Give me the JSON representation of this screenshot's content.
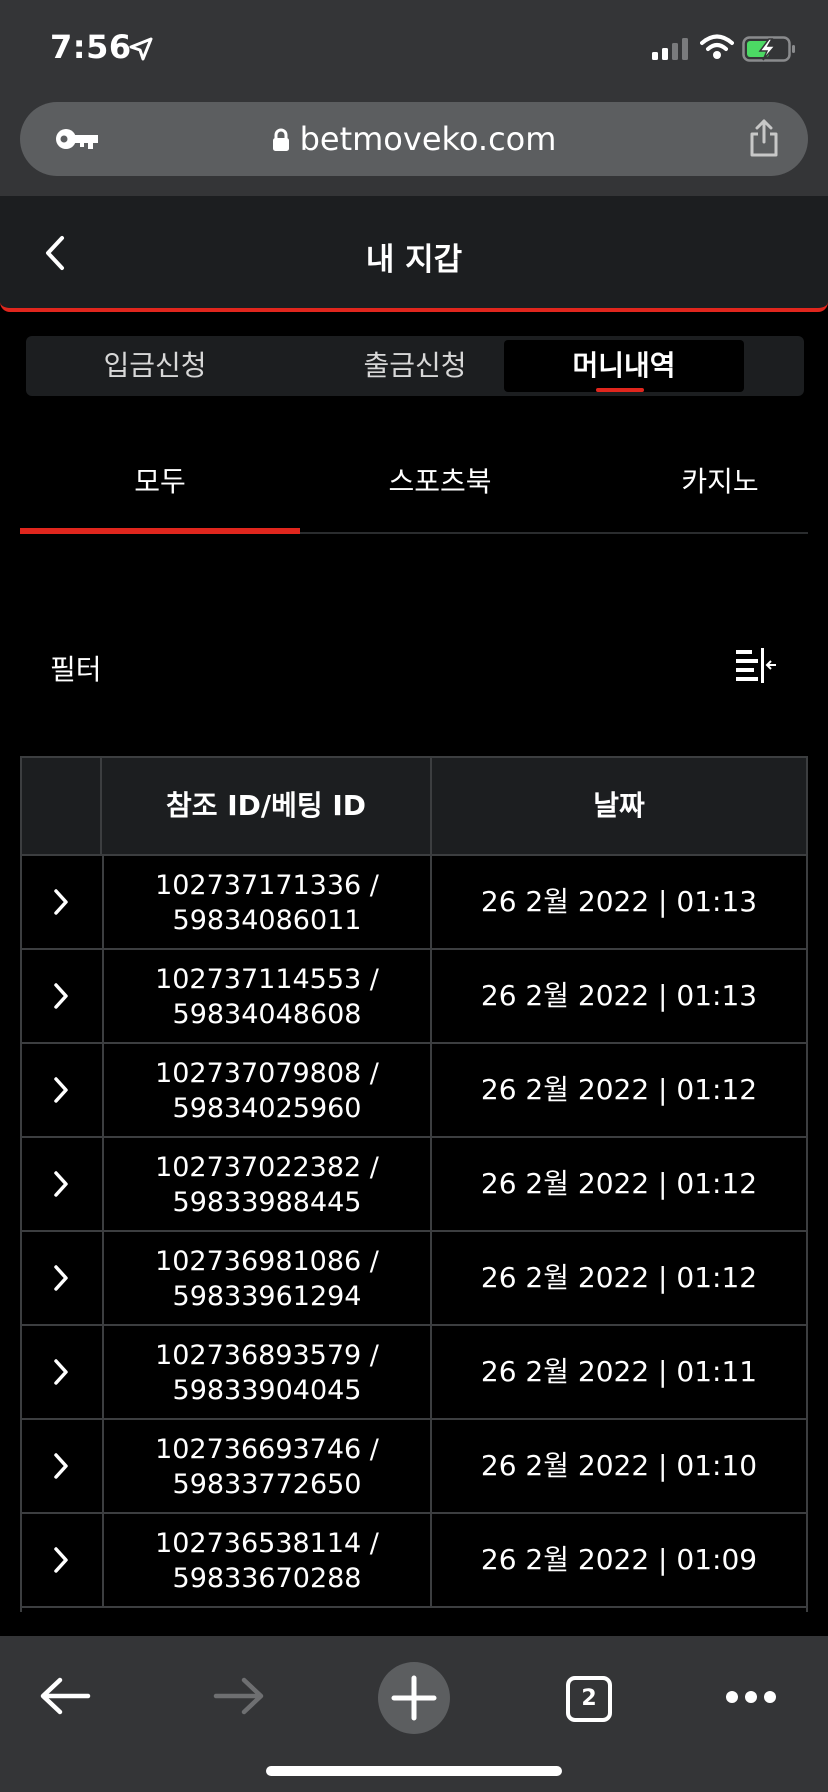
{
  "status_bar": {
    "time": "7:56"
  },
  "browser": {
    "url": "betmoveko.com",
    "tab_count": "2"
  },
  "header": {
    "title": "내 지갑"
  },
  "segments": [
    {
      "label": "입금신청",
      "active": false
    },
    {
      "label": "출금신청",
      "active": false
    },
    {
      "label": "머니내역",
      "active": true
    }
  ],
  "subtabs": [
    {
      "label": "모두",
      "active": true
    },
    {
      "label": "스포츠북",
      "active": false
    },
    {
      "label": "카지노",
      "active": false
    }
  ],
  "filter": {
    "label": "필터"
  },
  "table": {
    "headers": [
      "",
      "참조 ID/베팅 ID",
      "날짜"
    ],
    "rows": [
      {
        "ref_id": "102737171336 /",
        "bet_id": "59834086011",
        "date": "26 2월 2022 | 01:13"
      },
      {
        "ref_id": "102737114553 /",
        "bet_id": "59834048608",
        "date": "26 2월 2022 | 01:13"
      },
      {
        "ref_id": "102737079808 /",
        "bet_id": "59834025960",
        "date": "26 2월 2022 | 01:12"
      },
      {
        "ref_id": "102737022382 /",
        "bet_id": "59833988445",
        "date": "26 2월 2022 | 01:12"
      },
      {
        "ref_id": "102736981086 /",
        "bet_id": "59833961294",
        "date": "26 2월 2022 | 01:12"
      },
      {
        "ref_id": "102736893579 /",
        "bet_id": "59833904045",
        "date": "26 2월 2022 | 01:11"
      },
      {
        "ref_id": "102736693746 /",
        "bet_id": "59833772650",
        "date": "26 2월 2022 | 01:10"
      },
      {
        "ref_id": "102736538114 /",
        "bet_id": "59833670288",
        "date": "26 2월 2022 | 01:09"
      }
    ]
  },
  "colors": {
    "accent": "#e0261d",
    "chrome": "#343537",
    "panel": "#1c1e20"
  }
}
